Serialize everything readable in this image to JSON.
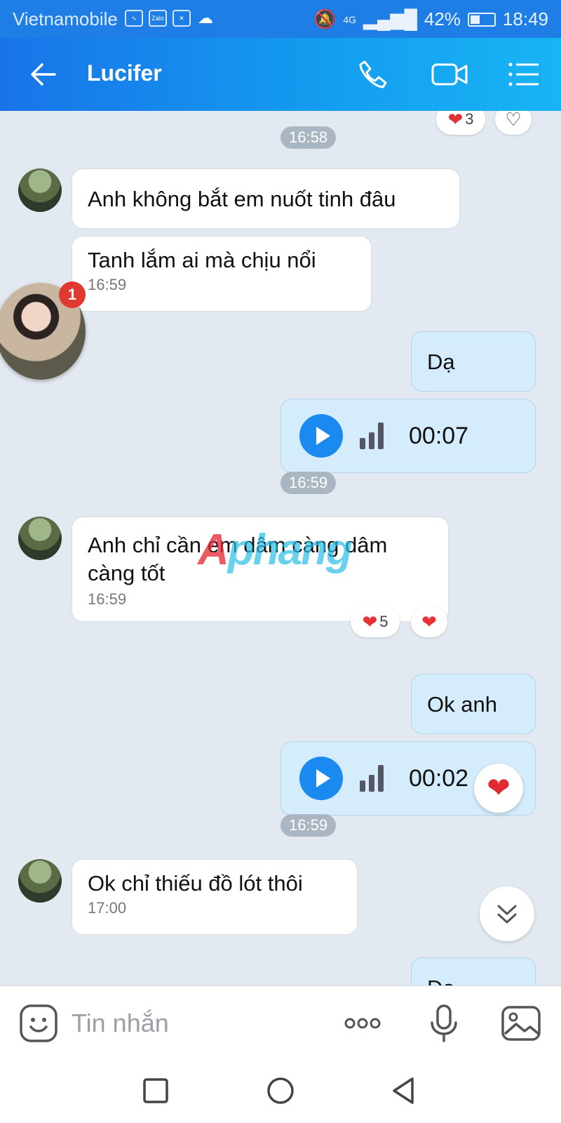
{
  "status_bar": {
    "carrier": "Vietnamobile",
    "network": "4G",
    "battery": "42%",
    "battery_level": 0.42,
    "time": "18:49"
  },
  "header": {
    "title": "Lucifer",
    "back_icon": "arrow-left-icon",
    "call_icon": "phone-icon",
    "video_icon": "video-camera-icon",
    "menu_icon": "menu-icon"
  },
  "chat": {
    "top_reactions": {
      "count": "3"
    },
    "chips": [
      "16:58",
      "16:59",
      "16:59"
    ],
    "messages": [
      {
        "text": "Anh không bắt em nuốt tinh đâu"
      },
      {
        "text": "Tanh lắm ai mà chịu nổi",
        "time": "16:59"
      },
      {
        "text": "Dạ"
      },
      {
        "voice_duration": "00:07"
      },
      {
        "text_line1": "Anh chỉ cần em dâm càng dâm",
        "text_line2": "càng tốt",
        "time": "16:59",
        "reaction_count": "5"
      },
      {
        "text": "Ok anh"
      },
      {
        "voice_duration": "00:02"
      },
      {
        "text": "Ok chỉ thiếu đồ lót thôi",
        "time": "17:00"
      },
      {
        "text": "Dạ"
      }
    ],
    "bubble_badge": "1",
    "watermark": {
      "red": "A",
      "rest": "phang"
    }
  },
  "input_bar": {
    "placeholder": "Tin nhắn"
  },
  "colors": {
    "header_start": "#1874e8",
    "header_end": "#19b4f4",
    "chat_background": "#e2e9f1",
    "outgoing_bubble": "#d4ecfc",
    "heart": "#e53238"
  }
}
